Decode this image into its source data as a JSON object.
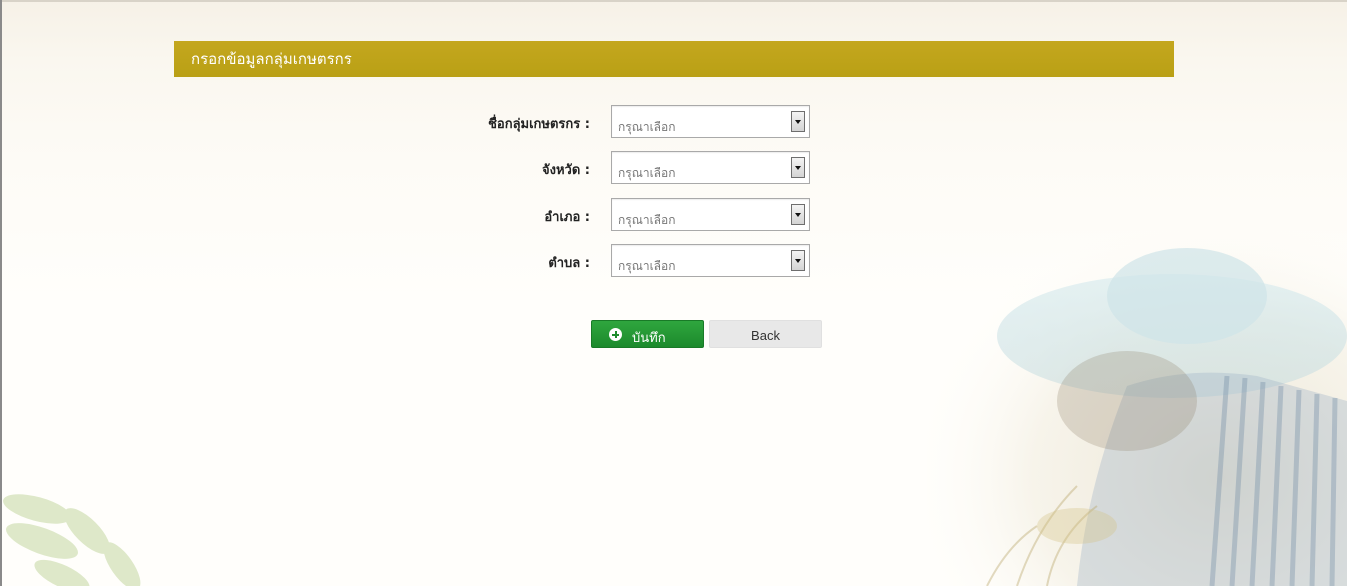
{
  "form": {
    "title": "กรอกข้อมูลกลุ่มเกษตรกร",
    "fields": [
      {
        "label": "ชื่อกลุ่มเกษตรกร :",
        "value": "กรุณาเลือก"
      },
      {
        "label": "จังหวัด :",
        "value": "กรุณาเลือก"
      },
      {
        "label": "อำเภอ :",
        "value": "กรุณาเลือก"
      },
      {
        "label": "ตำบล :",
        "value": "กรุณาเลือก"
      }
    ]
  },
  "buttons": {
    "save_label": "บันทึก",
    "back_label": "Back"
  },
  "colors": {
    "header_bar": "#bfa41a",
    "save_button": "#25993a",
    "back_button": "#e8e8e8"
  },
  "icons": {
    "save": "plus-circle-icon",
    "dropdown": "chevron-down-icon"
  }
}
